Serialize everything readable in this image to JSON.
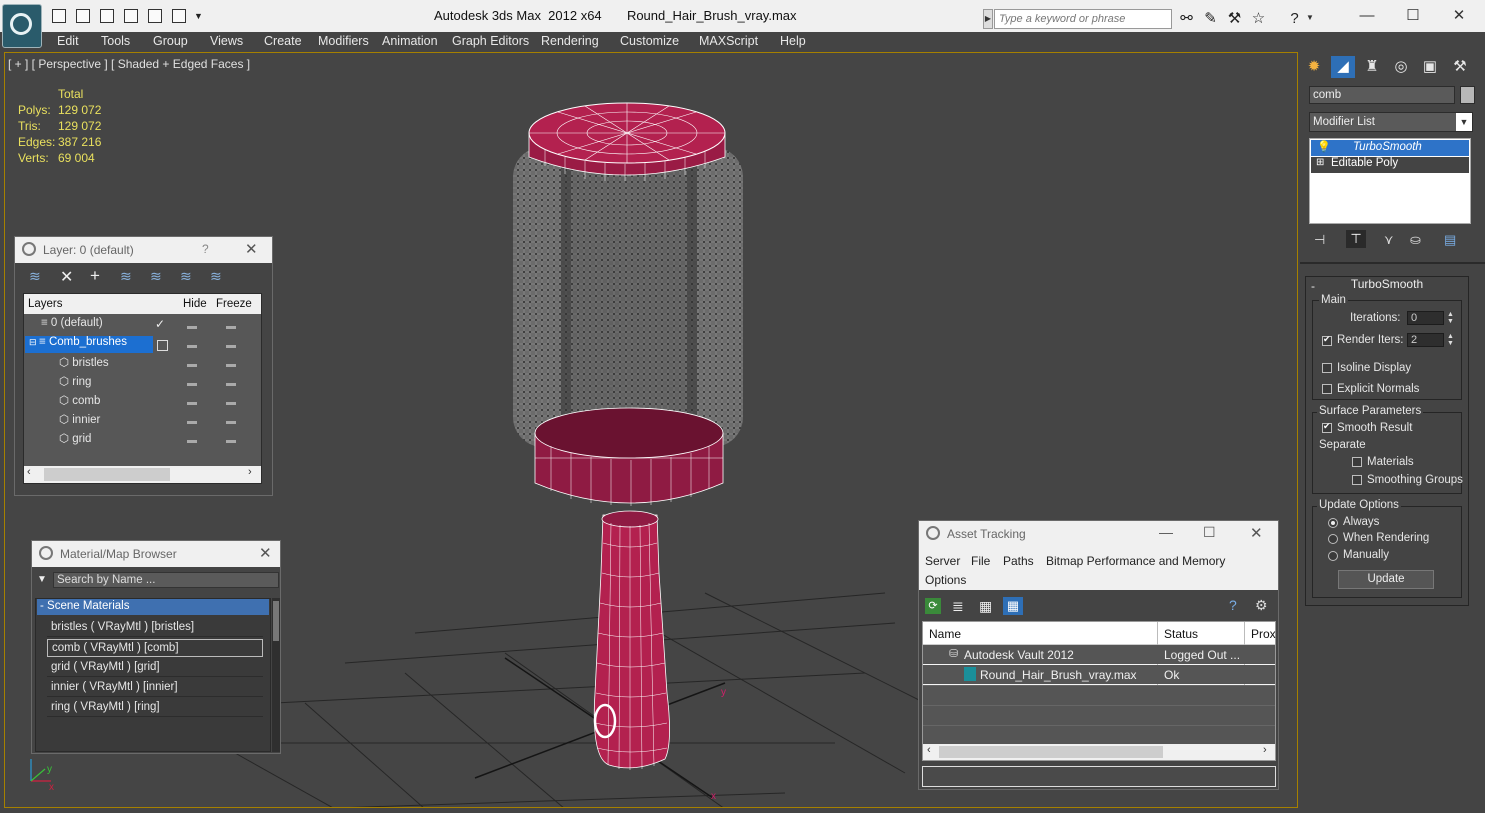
{
  "app": {
    "title": "Autodesk 3ds Max  2012 x64       Round_Hair_Brush_vray.max",
    "search_placeholder": "Type a keyword or phrase"
  },
  "menu": [
    "Edit",
    "Tools",
    "Group",
    "Views",
    "Create",
    "Modifiers",
    "Animation",
    "Graph Editors",
    "Rendering",
    "Customize",
    "MAXScript",
    "Help"
  ],
  "viewport": {
    "label": "[ + ] [ Perspective ] [ Shaded + Edged Faces ]",
    "stats": {
      "header": "Total",
      "rows": [
        {
          "label": "Polys:",
          "value": "129 072"
        },
        {
          "label": "Tris:",
          "value": "129 072"
        },
        {
          "label": "Edges:",
          "value": "387 216"
        },
        {
          "label": "Verts:",
          "value": "69 004"
        }
      ]
    },
    "axis_labels": {
      "x": "x",
      "y": "y"
    },
    "colors": {
      "mesh": "#b0204f",
      "wire": "#ffffff",
      "bristles": "#8a8a8a",
      "grid": "#1e1e1e",
      "selection_border": "#a58000"
    }
  },
  "layer_window": {
    "title": "Layer: 0 (default)",
    "help": "?",
    "columns": {
      "layers": "Layers",
      "hide": "Hide",
      "freeze": "Freeze"
    },
    "rows": [
      {
        "name": "0 (default)"
      },
      {
        "name": "Comb_brushes"
      },
      {
        "name": "bristles"
      },
      {
        "name": "ring"
      },
      {
        "name": "comb"
      },
      {
        "name": "innier"
      },
      {
        "name": "grid"
      }
    ]
  },
  "material_browser": {
    "title": "Material/Map Browser",
    "search_placeholder": "Search by Name ...",
    "group": "- Scene Materials",
    "items": [
      "bristles  ( VRayMtl ) [bristles]",
      "comb  ( VRayMtl ) [comb]",
      "grid  ( VRayMtl ) [grid]",
      "innier  ( VRayMtl ) [innier]",
      "ring  ( VRayMtl ) [ring]"
    ]
  },
  "asset_tracking": {
    "title": "Asset Tracking",
    "menu": [
      "Server",
      "File",
      "Paths",
      "Bitmap Performance and Memory",
      "Options"
    ],
    "columns": {
      "name": "Name",
      "status": "Status",
      "proxy": "Prox"
    },
    "rows": [
      {
        "name": "Autodesk Vault 2012",
        "status": "Logged Out ..."
      },
      {
        "name": "Round_Hair_Brush_vray.max",
        "status": "Ok"
      }
    ]
  },
  "command_panel": {
    "object_name": "comb",
    "modifier_list": "Modifier List",
    "stack": [
      "TurboSmooth",
      "Editable Poly"
    ],
    "rollout_title": "TurboSmooth",
    "main": {
      "title": "Main",
      "iterations_label": "Iterations:",
      "iterations_value": "0",
      "render_iters_label": "Render Iters:",
      "render_iters_value": "2",
      "isoline": "Isoline Display",
      "explicit": "Explicit Normals"
    },
    "surface": {
      "title": "Surface Parameters",
      "smooth_result": "Smooth Result",
      "separate": "Separate",
      "materials": "Materials",
      "smoothing_groups": "Smoothing Groups"
    },
    "update": {
      "title": "Update Options",
      "always": "Always",
      "when_rendering": "When Rendering",
      "manually": "Manually",
      "button": "Update"
    }
  }
}
